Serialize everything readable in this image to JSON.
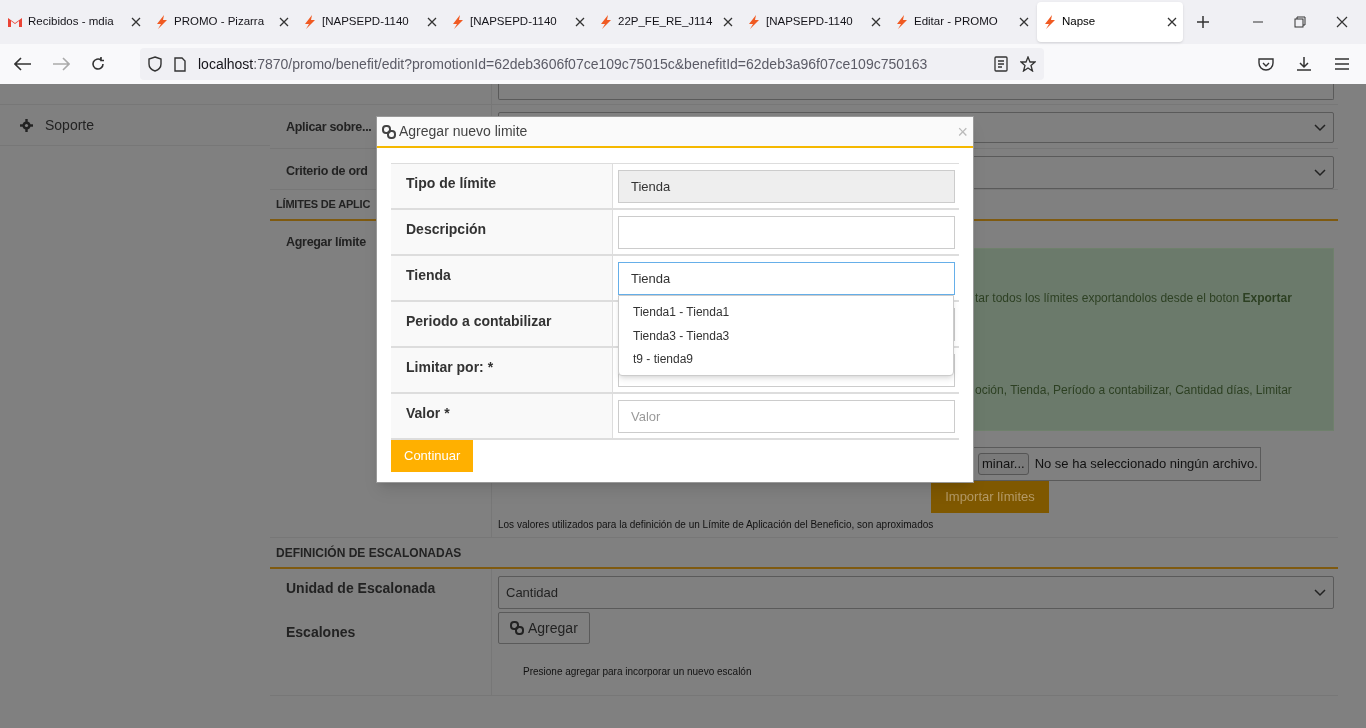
{
  "browser": {
    "tabs": [
      {
        "title": "Recibidos - mdia",
        "kind": "gmail",
        "selected": false
      },
      {
        "title": "PROMO - Pizarra",
        "kind": "napse",
        "selected": false
      },
      {
        "title": "[NAPSEPD-1140",
        "kind": "napse",
        "selected": false
      },
      {
        "title": "[NAPSEPD-1140",
        "kind": "napse",
        "selected": false
      },
      {
        "title": "22P_FE_RE_J114",
        "kind": "napse",
        "selected": false
      },
      {
        "title": "[NAPSEPD-1140",
        "kind": "napse",
        "selected": false
      },
      {
        "title": "Editar - PROMO",
        "kind": "napse",
        "selected": false
      },
      {
        "title": "Napse",
        "kind": "napse",
        "selected": true
      }
    ],
    "url_host": "localhost",
    "url_rest": ":7870/promo/benefit/edit?promotionId=62deb3606f07ce109c75015c&benefitId=62deb3a96f07ce109c750163"
  },
  "sidebar": {
    "items": [
      {
        "label": "Soporte"
      }
    ]
  },
  "form": {
    "rows": [
      {
        "label": "Aplicar sobre..."
      },
      {
        "label": "Criterio de ord"
      }
    ],
    "limits_section": {
      "title": "LÍMITES DE APLIC",
      "row_label": "Agregar límite",
      "info_lines": [
        "tar todos los límites exportandolos desde el boton **Exportar**",
        "oción, Tienda, Período a contabilizar, Cantidad días, Limitar"
      ],
      "file_button": "minar...",
      "file_status": "No se ha seleccionado ningún archivo.",
      "import_button": "Importar límites",
      "note": "Los valores utilizados para la definición de un Límite de Aplicación del Beneficio, son aproximados"
    },
    "steps_section": {
      "title": "DEFINICIÓN DE ESCALONADAS",
      "unit_label": "Unidad de Escalonada",
      "unit_value": "Cantidad",
      "steps_label": "Escalones",
      "add_button": "Agregar",
      "note": "Presione agregar para incorporar un nuevo escalón"
    }
  },
  "modal": {
    "title": "Agregar nuevo limite",
    "close": "×",
    "fields": [
      {
        "label": "Tipo de límite",
        "value": "Tienda",
        "disabled": true,
        "focused": false
      },
      {
        "label": "Descripción",
        "disabled": false,
        "focused": false
      },
      {
        "label": "Tienda",
        "value": "Tienda",
        "disabled": false,
        "focused": true
      },
      {
        "label": "Periodo a contabilizar",
        "focused": false
      },
      {
        "label": "Limitar por: *",
        "focused": false
      },
      {
        "label": "Valor *",
        "placeholder": "Valor",
        "disabled": false,
        "focused": false
      }
    ],
    "suggestions": [
      "Tienda1 - Tienda1",
      "Tienda3 - Tienda3",
      "t9 - tienda9"
    ],
    "submit": "Continuar"
  }
}
